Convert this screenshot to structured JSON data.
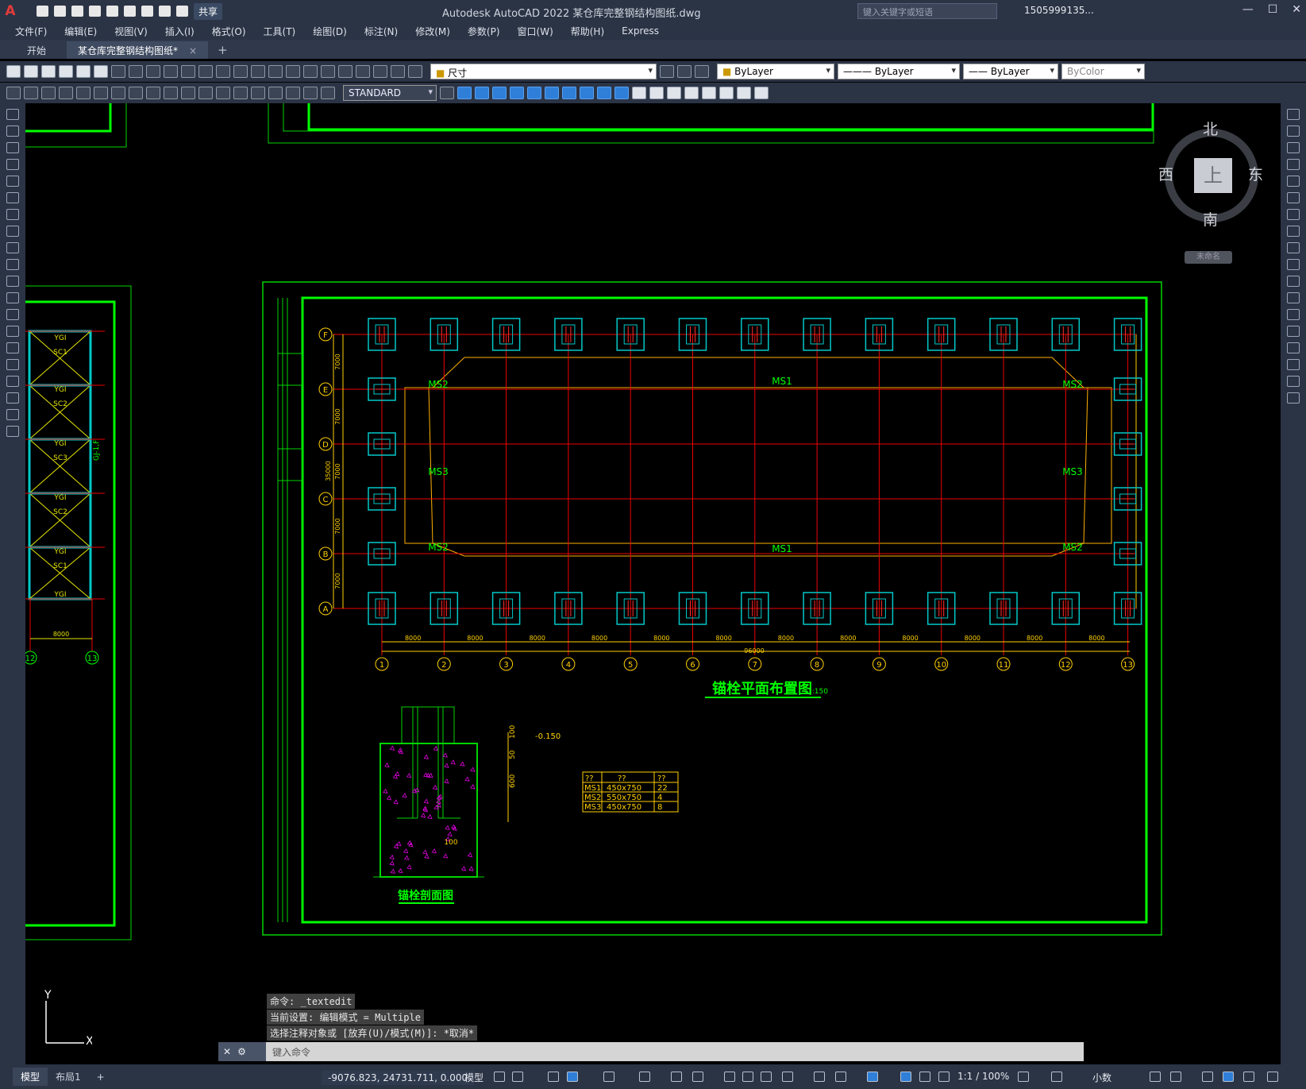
{
  "titlebar": {
    "app_logo": "A",
    "title": "Autodesk AutoCAD 2022    某仓库完整钢结构图纸.dwg",
    "share_label": "共享",
    "search_placeholder": "键入关键字或短语",
    "user": "1505999135...",
    "window_controls": [
      "—",
      "☐",
      "✕"
    ]
  },
  "menubar": {
    "items": [
      "文件(F)",
      "编辑(E)",
      "视图(V)",
      "插入(I)",
      "格式(O)",
      "工具(T)",
      "绘图(D)",
      "标注(N)",
      "修改(M)",
      "参数(P)",
      "窗口(W)",
      "帮助(H)",
      "Express"
    ]
  },
  "file_tabs": {
    "start": "开始",
    "active": "某仓库完整钢结构图纸*",
    "close": "×",
    "new": "+"
  },
  "properties": {
    "layer": "尺寸",
    "color": "ByLayer",
    "linetype": "ByLayer",
    "lineweight": "ByLayer",
    "plotstyle": "ByColor",
    "textstyle": "STANDARD"
  },
  "viewcube": {
    "north": "北",
    "south": "南",
    "west": "西",
    "east": "东",
    "top": "上",
    "ucs_name": "未命名"
  },
  "drawing": {
    "plan_title": "锚栓平面布置图",
    "plan_scale": "1:150",
    "section_title": "锚栓剖面图",
    "grid_x": [
      "1",
      "2",
      "3",
      "4",
      "5",
      "6",
      "7",
      "8",
      "9",
      "10",
      "11",
      "12",
      "13"
    ],
    "grid_y": [
      "F",
      "E",
      "D",
      "C",
      "B",
      "A"
    ],
    "bay_dim": "8000",
    "total_dim": "96000",
    "side_dim": "7000",
    "side_total": "35000",
    "ms_labels": {
      "ms1": "MS1",
      "ms2": "MS2",
      "ms3": "MS3"
    },
    "elev": "-0.150",
    "table": {
      "headers": [
        "??",
        "??",
        "??"
      ],
      "rows": [
        [
          "MS1",
          "450x750",
          "22"
        ],
        [
          "MS2",
          "550x750",
          "4"
        ],
        [
          "MS3",
          "450x750",
          "8"
        ]
      ]
    },
    "section_dims": [
      "100",
      "50",
      "600",
      "100"
    ],
    "frame_labels": [
      "YGI",
      "SC1",
      "YGI",
      "SC2",
      "YGI",
      "SC3",
      "YGI",
      "SC2",
      "YGI",
      "SC1",
      "YGI"
    ],
    "frame_side": "GJ-1,F",
    "frame_dim": "8000",
    "frame_grid": [
      "12",
      "13"
    ]
  },
  "command": {
    "history": [
      "命令: _textedit",
      "当前设置: 编辑模式 = Multiple",
      "选择注释对象或 [放弃(U)/模式(M)]: *取消*"
    ],
    "placeholder": "键入命令"
  },
  "statusbar": {
    "model_tab": "模型",
    "layout_tab": "布局1",
    "add": "+",
    "coords": "-9076.823, 24731.711, 0.000",
    "model": "模型",
    "scale": "1:1 / 100%",
    "units": "小数"
  }
}
